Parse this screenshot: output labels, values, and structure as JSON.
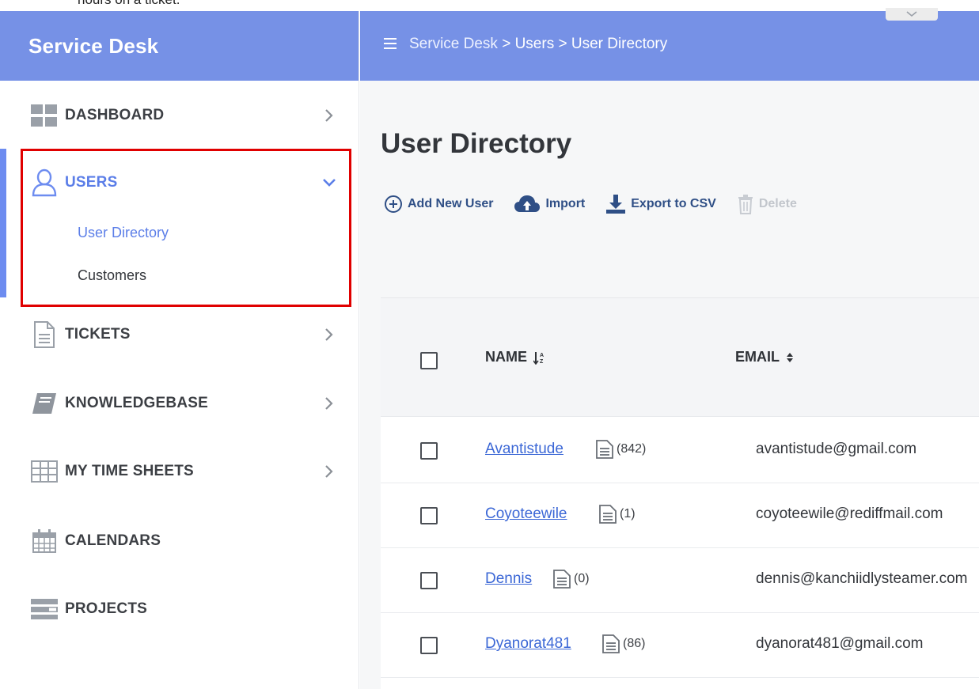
{
  "caption": "hours on a ticket.",
  "sidebar": {
    "brand": "Service Desk",
    "items": [
      {
        "label": "DASHBOARD"
      },
      {
        "label": "USERS"
      },
      {
        "label": "TICKETS"
      },
      {
        "label": "KNOWLEDGEBASE"
      },
      {
        "label": "MY TIME SHEETS"
      },
      {
        "label": "CALENDARS"
      },
      {
        "label": "PROJECTS"
      }
    ],
    "users_sub": [
      {
        "label": "User Directory",
        "active": true
      },
      {
        "label": "Customers",
        "active": false
      }
    ]
  },
  "header": {
    "breadcrumb_root": "Service Desk",
    "breadcrumb_rest": " > Users > User Directory"
  },
  "main": {
    "title": "User Directory",
    "toolbar": {
      "add": "Add New User",
      "import": "Import",
      "export": "Export to CSV",
      "delete": "Delete"
    },
    "table": {
      "columns": [
        "NAME",
        "EMAIL"
      ],
      "rows": [
        {
          "name": "Avantistude",
          "count": "(842)",
          "email": "avantistude@gmail.com"
        },
        {
          "name": "Coyoteewile",
          "count": "(1)",
          "email": "coyoteewile@rediffmail.com"
        },
        {
          "name": "Dennis",
          "count": "(0)",
          "email": "dennis@kanchiidlysteamer.com"
        },
        {
          "name": "Dyanorat481",
          "count": "(86)",
          "email": "dyanorat481@gmail.com"
        }
      ]
    }
  },
  "colors": {
    "brand_bar": "#7691e6",
    "active_accent": "#6d8cf0",
    "highlight_box": "#e00000",
    "link": "#3b67d6",
    "toolbar_text": "#2f4f86"
  },
  "icons": {
    "dashboard": "grid-icon",
    "users": "user-outline-icon",
    "tickets": "document-icon",
    "knowledgebase": "book-icon",
    "timesheets": "table-grid-icon",
    "calendars": "calendar-icon",
    "projects": "server-stack-icon"
  }
}
